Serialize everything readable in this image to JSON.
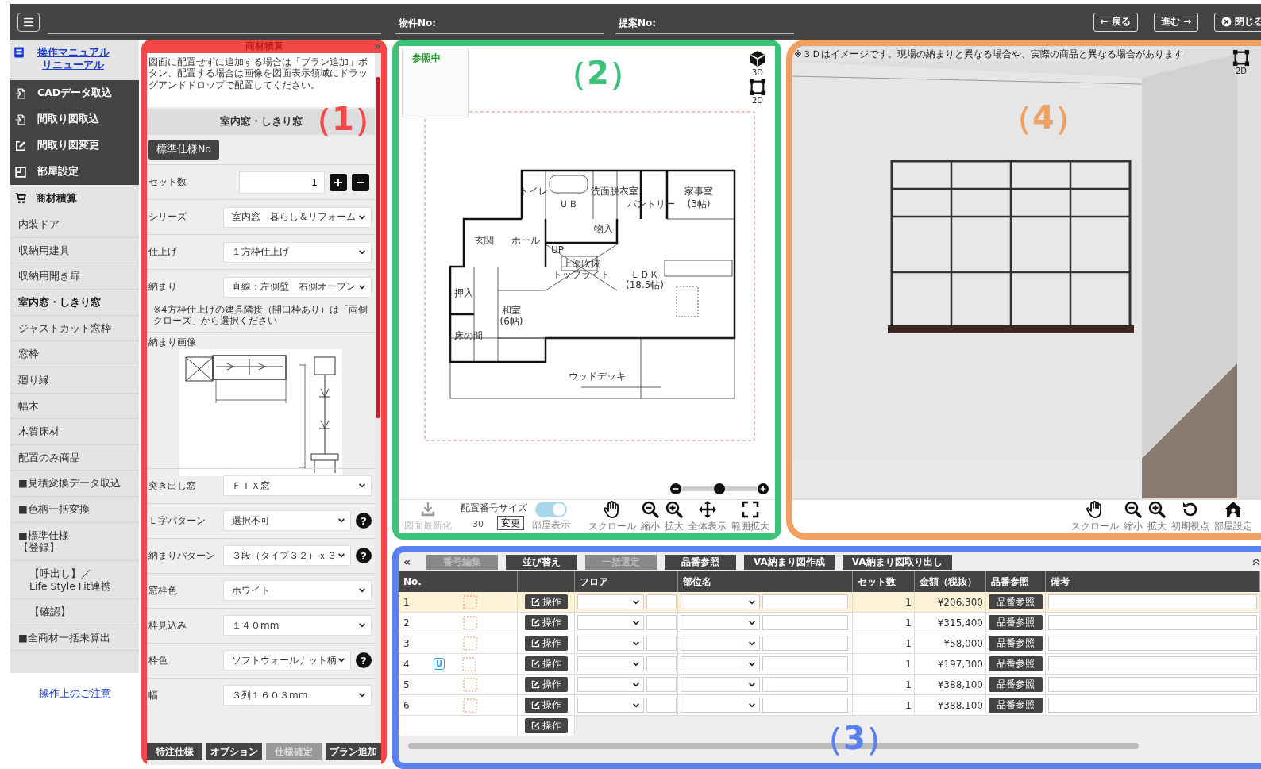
{
  "top_bar": {
    "fields": [
      {
        "label": "物件No:"
      },
      {
        "label": "提案No:"
      }
    ],
    "buttons": [
      {
        "label": "← 戻る"
      },
      {
        "label": "進む →"
      },
      {
        "label": "閉じる"
      }
    ]
  },
  "sidebar": {
    "manual_link": "操作マニュアルリニューアル",
    "tools": [
      {
        "label": "CADデータ取込"
      },
      {
        "label": "間取り図取込"
      },
      {
        "label": "間取り図変更"
      },
      {
        "label": "部屋設定"
      }
    ],
    "section": "商材積算",
    "items": [
      {
        "label": "内装ドア",
        "selected": false
      },
      {
        "label": "収納用建具",
        "selected": false
      },
      {
        "label": "収納用開き扉",
        "selected": false
      },
      {
        "label": "室内窓・しきり窓",
        "selected": true
      },
      {
        "label": "ジャストカット窓枠",
        "selected": false
      },
      {
        "label": "窓枠",
        "selected": false
      },
      {
        "label": "廻り縁",
        "selected": false
      },
      {
        "label": "幅木",
        "selected": false
      },
      {
        "label": "木質床材",
        "selected": false
      },
      {
        "label": "配置のみ商品",
        "selected": false
      },
      {
        "label": "■見積変換データ取込",
        "selected": false
      },
      {
        "label": "■色柄一括変換",
        "selected": false
      },
      {
        "label": "■標準仕様【登録】",
        "selected": false,
        "children": [
          {
            "label": "【呼出し】／\nLife Style Fit連携",
            "selected": false
          },
          {
            "label": "【確認】",
            "selected": false
          }
        ]
      },
      {
        "label": "■全商材一括未算出",
        "selected": false
      }
    ],
    "notice_link": "操作上のご注意"
  },
  "estimate_panel": {
    "title": "商材積算",
    "collapse": "»",
    "description": "図面に配置せずに追加する場合は「プラン追加」ボタン、配置する場合は画像を図面表示領域にドラッグアンドドロップで配置してください。",
    "heading": "室内窓・しきり窓",
    "spec_button": "標準仕様No",
    "set_count": {
      "label": "セット数",
      "value": "1"
    },
    "rows": [
      {
        "kind": "select",
        "label": "シリーズ",
        "value": "室内窓　暮らし＆リフォーム"
      },
      {
        "kind": "select",
        "label": "仕上げ",
        "value": "１方枠仕上げ"
      },
      {
        "kind": "select",
        "label": "納まり",
        "value": "直線：左側壁　右側オープン",
        "note": "※4方枠仕上げの建具隣接（開口枠あり）は「両側クローズ」から選択ください"
      },
      {
        "kind": "image",
        "label": "納まり画像"
      },
      {
        "kind": "select",
        "label": "突き出し窓",
        "value": "ＦＩＸ窓"
      },
      {
        "kind": "select",
        "label": "Ｌ字パターン",
        "value": "選択不可",
        "help": "?"
      },
      {
        "kind": "select",
        "label": "納まりパターン",
        "value": "３段（タイプ３２）ｘ３",
        "help": "?"
      },
      {
        "kind": "select",
        "label": "窓枠色",
        "value": "ホワイト"
      },
      {
        "kind": "select",
        "label": "枠見込み",
        "value": "１４０mm"
      },
      {
        "kind": "select",
        "label": "枠色",
        "value": "ソフトウォールナット柄",
        "help": "?"
      },
      {
        "kind": "select",
        "label": "幅",
        "value": "３列１６０３mm"
      }
    ],
    "buttons": [
      {
        "label": "特注仕様",
        "disabled": false
      },
      {
        "label": "オプション",
        "disabled": false
      },
      {
        "label": "仕様確定",
        "disabled": true
      },
      {
        "label": "プラン追加",
        "disabled": false
      }
    ]
  },
  "plan_view": {
    "reference_label": "参照中",
    "view_buttons": [
      {
        "label": "3D"
      },
      {
        "label": "2D"
      }
    ],
    "rooms": [
      "トイレ",
      "洗面脱衣室",
      "家事室",
      "ＵＢ",
      "パントリー",
      "(3帖)",
      "物入",
      "玄関",
      "ホール",
      "UP",
      "上部吹抜",
      "トップライト",
      "ＬＤＫ",
      "(18.5帖)",
      "押入",
      "和室",
      "(6帖)",
      "床の間",
      "ウッドデッキ"
    ],
    "zoom_slider": {
      "level": 0.5
    },
    "refresh": {
      "label": "図面最新化",
      "disabled": true
    },
    "number_size": {
      "label": "配置番号サイズ",
      "value": "30",
      "button": "変更"
    },
    "room_toggle": {
      "label": "部屋表示",
      "on": true
    },
    "tools": [
      {
        "label": "スクロール"
      },
      {
        "label": "縮小"
      },
      {
        "label": "拡大"
      },
      {
        "label": "全体表示"
      },
      {
        "label": "範囲拡大"
      }
    ]
  },
  "render_view": {
    "notice": "※３Ｄはイメージです。現場の納まりと異なる場合や、実際の商品と異なる場合があります",
    "view_button": "2D",
    "tools": [
      {
        "label": "スクロール"
      },
      {
        "label": "縮小"
      },
      {
        "label": "拡大"
      },
      {
        "label": "初期視点"
      },
      {
        "label": "部屋設定"
      }
    ]
  },
  "list_panel": {
    "collapse": "«",
    "buttons": [
      {
        "label": "番号編集",
        "disabled": true
      },
      {
        "label": "並び替え",
        "disabled": false
      },
      {
        "label": "一括選定",
        "disabled": true
      },
      {
        "label": "品番参照",
        "disabled": false
      },
      {
        "label": "VA納まり図作成",
        "disabled": false
      },
      {
        "label": "VA納まり図取り出し",
        "disabled": false
      }
    ],
    "columns": [
      "No.",
      "フロア",
      "部位名",
      "セット数",
      "金額（税抜）",
      "品番参照",
      "備考"
    ],
    "rows": [
      {
        "no": "1",
        "set_count": "1",
        "price": "¥206,300",
        "part_button": "品番参照",
        "action": "操作",
        "selected": true
      },
      {
        "no": "2",
        "set_count": "1",
        "price": "¥315,400",
        "part_button": "品番参照",
        "action": "操作",
        "selected": false
      },
      {
        "no": "3",
        "set_count": "1",
        "price": "¥58,000",
        "part_button": "品番参照",
        "action": "操作",
        "selected": false
      },
      {
        "no": "4",
        "badge": "U",
        "set_count": "1",
        "price": "¥197,300",
        "part_button": "品番参照",
        "action": "操作",
        "selected": false
      },
      {
        "no": "5",
        "set_count": "1",
        "price": "¥388,100",
        "part_button": "品番参照",
        "action": "操作",
        "selected": false
      },
      {
        "no": "6",
        "set_count": "1",
        "price": "¥388,100",
        "part_button": "品番参照",
        "action": "操作",
        "selected": false
      },
      {
        "action": "操作",
        "selected": false
      }
    ]
  },
  "annotations": [
    {
      "label": "（1）",
      "color": "#f44848"
    },
    {
      "label": "（2）",
      "color": "#3cc37a"
    },
    {
      "label": "（3）",
      "color": "#5b80f2"
    },
    {
      "label": "（4）",
      "color": "#f0a060"
    }
  ]
}
